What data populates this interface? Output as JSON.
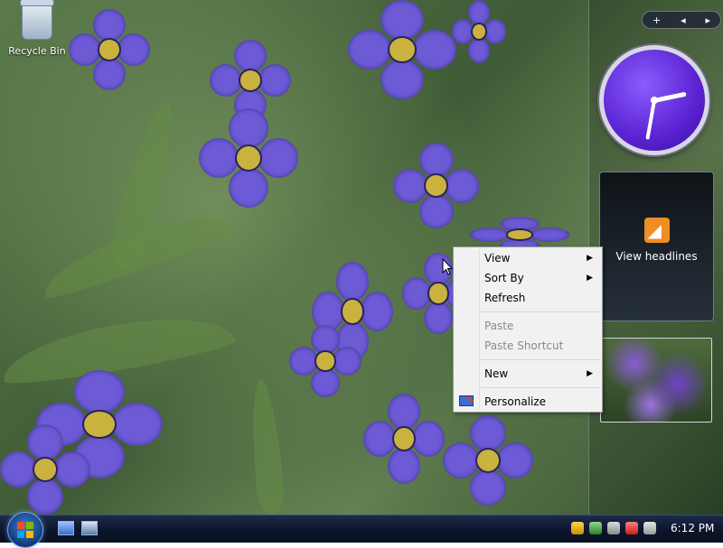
{
  "desktop": {
    "recycle_bin_label": "Recycle Bin"
  },
  "sidebar": {
    "controls": {
      "add_label": "+",
      "prev_label": "◂",
      "next_label": "▸"
    },
    "clock_gadget": {
      "hour_hand_angle_deg": -12,
      "minute_hand_angle_deg": 100
    },
    "feed_gadget": {
      "label": "View headlines",
      "icon": "rss-icon"
    },
    "slideshow_gadget": {
      "icon": "flowers-photo"
    }
  },
  "context_menu": {
    "items": [
      {
        "label": "View",
        "has_submenu": true,
        "enabled": true
      },
      {
        "label": "Sort By",
        "has_submenu": true,
        "enabled": true
      },
      {
        "label": "Refresh",
        "has_submenu": false,
        "enabled": true
      },
      {
        "label": "Paste",
        "has_submenu": false,
        "enabled": false
      },
      {
        "label": "Paste Shortcut",
        "has_submenu": false,
        "enabled": false
      },
      {
        "label": "New",
        "has_submenu": true,
        "enabled": true
      },
      {
        "label": "Personalize",
        "has_submenu": false,
        "enabled": true,
        "icon": "personalize-icon"
      }
    ],
    "submenu_arrow": "▶"
  },
  "taskbar": {
    "start_button_icon": "windows-logo-icon",
    "quick_launch": [
      {
        "icon": "show-desktop-icon"
      },
      {
        "icon": "switch-windows-icon"
      }
    ],
    "tray_icons": [
      "security-shield-icon",
      "network-icon",
      "display-icon",
      "alert-icon",
      "volume-icon"
    ],
    "clock": "6:12 PM"
  }
}
